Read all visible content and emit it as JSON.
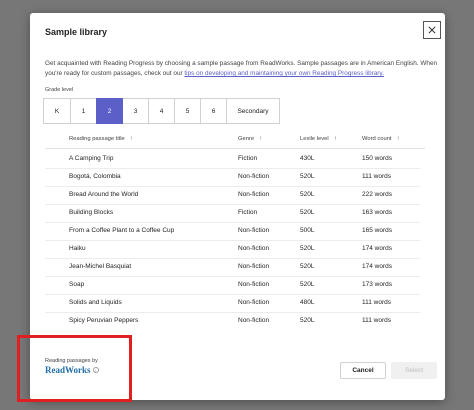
{
  "dialog": {
    "title": "Sample library",
    "description": "Get acquainted with Reading Progress by choosing a sample passage from ReadWorks. Sample passages are in American English. When you're ready for custom passages, check out our ",
    "link_text": "tips on developing and maintaining your own Reading Progress library."
  },
  "grade_level": {
    "label": "Grade level",
    "options": [
      "K",
      "1",
      "2",
      "3",
      "4",
      "5",
      "6",
      "Secondary"
    ],
    "selected": "2"
  },
  "table": {
    "headers": [
      "Reading passage title",
      "Genre",
      "Lexile level",
      "Word count"
    ],
    "rows": [
      [
        "A Camping Trip",
        "Fiction",
        "430L",
        "150 words"
      ],
      [
        "Bogotá, Colombia",
        "Non-fiction",
        "520L",
        "111 words"
      ],
      [
        "Bread Around the World",
        "Non-fiction",
        "520L",
        "222 words"
      ],
      [
        "Building Blocks",
        "Fiction",
        "520L",
        "163 words"
      ],
      [
        "From a Coffee Plant to a Coffee Cup",
        "Non-fiction",
        "500L",
        "165 words"
      ],
      [
        "Haiku",
        "Non-fiction",
        "520L",
        "174 words"
      ],
      [
        "Jean-Michel Basquiat",
        "Non-fiction",
        "520L",
        "174 words"
      ],
      [
        "Soap",
        "Non-fiction",
        "520L",
        "173 words"
      ],
      [
        "Solids and Liquids",
        "Non-fiction",
        "480L",
        "111 words"
      ],
      [
        "Spicy Peruvian Peppers",
        "Non-fiction",
        "520L",
        "111 words"
      ]
    ]
  },
  "footer": {
    "powered_by": "Reading passages by",
    "logo_text": "ReadWorks",
    "cancel_label": "Cancel",
    "select_label": "Select"
  },
  "colors": {
    "accent": "#5b5fc7",
    "highlight": "#e02020"
  },
  "icons": {
    "close": "close-icon",
    "sort": "sort-arrow-icon",
    "info": "info-icon"
  }
}
